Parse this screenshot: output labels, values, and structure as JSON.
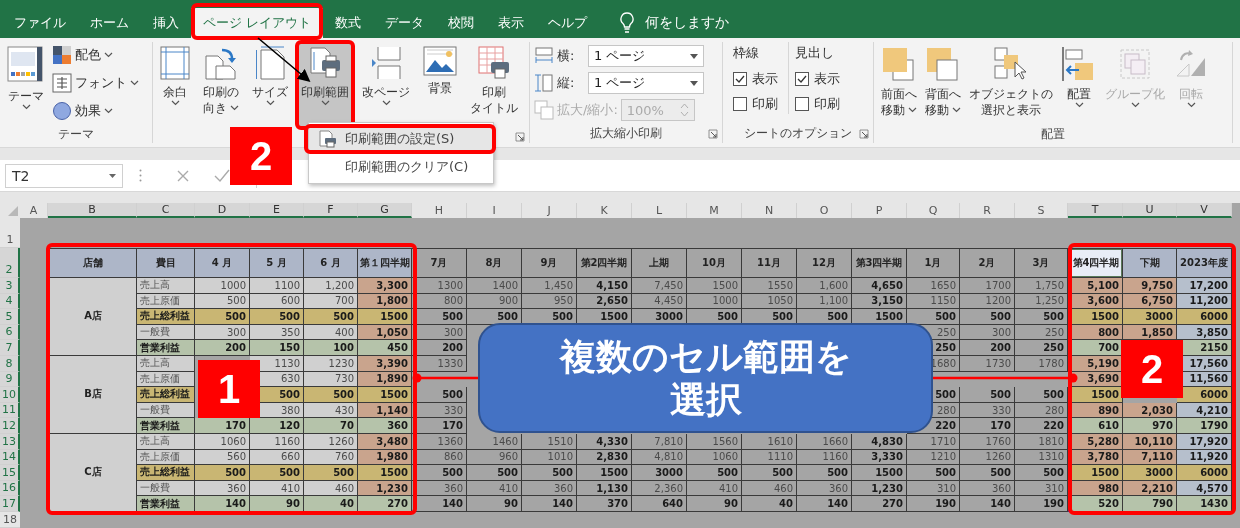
{
  "tabs": [
    {
      "label": "ファイル",
      "selected": false
    },
    {
      "label": "ホーム",
      "selected": false
    },
    {
      "label": "挿入",
      "selected": false
    },
    {
      "label": "ページ レイアウト",
      "selected": true
    },
    {
      "label": "数式",
      "selected": false
    },
    {
      "label": "データ",
      "selected": false
    },
    {
      "label": "校閲",
      "selected": false
    },
    {
      "label": "表示",
      "selected": false
    },
    {
      "label": "ヘルプ",
      "selected": false
    }
  ],
  "tell_me": {
    "placeholder": "何をしますか"
  },
  "ribbon": {
    "theme": {
      "label": "テーマ",
      "button": {
        "lines": [
          "テーマ"
        ],
        "dropdown": true
      },
      "options": [
        {
          "label": "配色"
        },
        {
          "label": "フォント"
        },
        {
          "label": "効果"
        }
      ]
    },
    "page_setup": {
      "buttons": [
        {
          "lines": [
            "余白"
          ],
          "dropdown": true,
          "pressed": false
        },
        {
          "lines": [
            "印刷の",
            "向き"
          ],
          "dropdown": true,
          "pressed": false
        },
        {
          "lines": [
            "サイズ"
          ],
          "dropdown": true,
          "pressed": false
        },
        {
          "lines": [
            "印刷範囲"
          ],
          "dropdown": true,
          "pressed": true
        },
        {
          "lines": [
            "改ページ"
          ],
          "dropdown": true,
          "pressed": false
        },
        {
          "lines": [
            "背景"
          ],
          "dropdown": false,
          "pressed": false
        },
        {
          "lines": [
            "印刷",
            "タイトル"
          ],
          "dropdown": false,
          "pressed": false
        }
      ]
    },
    "scale": {
      "label": "拡大縮小印刷",
      "fields": [
        {
          "label": "横:",
          "value": "1 ページ",
          "kind": "dropdown",
          "disabled": false
        },
        {
          "label": "縦:",
          "value": "1 ページ",
          "kind": "dropdown",
          "disabled": false
        },
        {
          "label": "拡大/縮小:",
          "value": "100%",
          "kind": "spinner",
          "disabled": true
        }
      ]
    },
    "sheet_options": {
      "label": "シートのオプション",
      "columns": [
        {
          "title": "枠線",
          "options": [
            {
              "label": "表示",
              "checked": true
            },
            {
              "label": "印刷",
              "checked": false
            }
          ]
        },
        {
          "title": "見出し",
          "options": [
            {
              "label": "表示",
              "checked": true
            },
            {
              "label": "印刷",
              "checked": false
            }
          ]
        }
      ]
    },
    "arrange": {
      "label": "配置",
      "buttons": [
        {
          "lines": [
            "前面へ",
            "移動"
          ],
          "dropdown": true,
          "disabled": false
        },
        {
          "lines": [
            "背面へ",
            "移動"
          ],
          "dropdown": true,
          "disabled": false
        },
        {
          "lines": [
            "オブジェクトの",
            "選択と表示"
          ],
          "dropdown": false,
          "disabled": false
        },
        {
          "lines": [
            "配置"
          ],
          "dropdown": true,
          "disabled": false
        },
        {
          "lines": [
            "グループ化"
          ],
          "dropdown": true,
          "disabled": true
        },
        {
          "lines": [
            "回転"
          ],
          "dropdown": true,
          "disabled": true
        }
      ]
    }
  },
  "print_area_menu": [
    {
      "label": "印刷範囲の設定(S)",
      "highlighted": true
    },
    {
      "label": "印刷範囲のクリア(C)",
      "highlighted": false
    }
  ],
  "name_box": "T2",
  "sheet": {
    "columns": [
      {
        "letter": "A",
        "selected": false
      },
      {
        "letter": "B",
        "selected": true,
        "print_area": true,
        "kind": "store",
        "header": "店舗",
        "active": false
      },
      {
        "letter": "C",
        "selected": true,
        "print_area": true,
        "kind": "item",
        "header": "費目",
        "active": false
      },
      {
        "letter": "D",
        "selected": true,
        "print_area": true,
        "kind": "month",
        "bold": false,
        "header": "4 月",
        "active": false
      },
      {
        "letter": "E",
        "selected": true,
        "print_area": true,
        "kind": "month",
        "bold": false,
        "header": "5 月",
        "active": false
      },
      {
        "letter": "F",
        "selected": true,
        "print_area": true,
        "kind": "month",
        "bold": false,
        "header": "6 月",
        "active": false
      },
      {
        "letter": "G",
        "selected": true,
        "print_area": true,
        "kind": "quarter",
        "bold": true,
        "header": "第１四半期",
        "active": false
      },
      {
        "letter": "H",
        "selected": false,
        "print_area": false,
        "bold": false,
        "header": "7月",
        "active": false
      },
      {
        "letter": "I",
        "selected": false,
        "print_area": false,
        "bold": false,
        "header": "8月",
        "active": false
      },
      {
        "letter": "J",
        "selected": false,
        "print_area": false,
        "bold": false,
        "header": "9月",
        "active": false
      },
      {
        "letter": "K",
        "selected": false,
        "print_area": false,
        "bold": true,
        "header": "第2四半期",
        "active": false
      },
      {
        "letter": "L",
        "selected": false,
        "print_area": false,
        "bold": false,
        "header": "上期",
        "active": false
      },
      {
        "letter": "M",
        "selected": false,
        "print_area": false,
        "bold": false,
        "header": "10月",
        "active": false
      },
      {
        "letter": "N",
        "selected": false,
        "print_area": false,
        "bold": false,
        "header": "11月",
        "active": false
      },
      {
        "letter": "O",
        "selected": false,
        "print_area": false,
        "bold": false,
        "header": "12月",
        "active": false
      },
      {
        "letter": "P",
        "selected": false,
        "print_area": false,
        "bold": true,
        "header": "第3四半期",
        "active": false
      },
      {
        "letter": "Q",
        "selected": false,
        "print_area": false,
        "bold": false,
        "header": "1月",
        "active": false
      },
      {
        "letter": "R",
        "selected": false,
        "print_area": false,
        "bold": false,
        "header": "2月",
        "active": false
      },
      {
        "letter": "S",
        "selected": false,
        "print_area": false,
        "bold": false,
        "header": "3月",
        "active": false
      },
      {
        "letter": "T",
        "selected": true,
        "print_area": true,
        "kind": "quarter",
        "bold": true,
        "header": "第4四半期",
        "active": true
      },
      {
        "letter": "U",
        "selected": true,
        "print_area": true,
        "kind": "half",
        "bold": true,
        "header": "下期",
        "active": false
      },
      {
        "letter": "V",
        "selected": true,
        "print_area": true,
        "kind": "year",
        "bold": true,
        "header": "2023年度",
        "active": false
      }
    ],
    "row_numbers": [
      {
        "label": "1",
        "selected": false
      },
      {
        "label": "2",
        "selected": true
      },
      {
        "label": "3",
        "selected": true
      },
      {
        "label": "4",
        "selected": true
      },
      {
        "label": "5",
        "selected": true
      },
      {
        "label": "6",
        "selected": true
      },
      {
        "label": "7",
        "selected": true
      },
      {
        "label": "8",
        "selected": true
      },
      {
        "label": "9",
        "selected": true
      },
      {
        "label": "10",
        "selected": true
      },
      {
        "label": "11",
        "selected": true
      },
      {
        "label": "12",
        "selected": true
      },
      {
        "label": "13",
        "selected": true
      },
      {
        "label": "14",
        "selected": true
      },
      {
        "label": "15",
        "selected": true
      },
      {
        "label": "16",
        "selected": true
      },
      {
        "label": "17",
        "selected": true
      },
      {
        "label": "18",
        "selected": false
      }
    ],
    "stores": [
      {
        "name": "A店",
        "rows": [
          {
            "item": "売上高",
            "kind": "sales",
            "values": {
              "D": "1000",
              "E": "1100",
              "F": "1,200",
              "G": "3,300",
              "H": "1300",
              "I": "1400",
              "J": "1,450",
              "K": "4,150",
              "L": "7,450",
              "M": "1500",
              "N": "1550",
              "O": "1,600",
              "P": "4,650",
              "Q": "1650",
              "R": "1700",
              "S": "1,750",
              "T": "5,100",
              "U": "9,750",
              "V": "17,200"
            }
          },
          {
            "item": "売上原価",
            "kind": "cost",
            "values": {
              "D": "500",
              "E": "600",
              "F": "700",
              "G": "1,800",
              "H": "800",
              "I": "900",
              "J": "950",
              "K": "2,650",
              "L": "4,450",
              "M": "1000",
              "N": "1050",
              "O": "1,100",
              "P": "3,150",
              "Q": "1150",
              "R": "1200",
              "S": "1,250",
              "T": "3,600",
              "U": "6,750",
              "V": "11,200"
            }
          },
          {
            "item": "売上総利益",
            "kind": "gross",
            "values": {
              "D": "500",
              "E": "500",
              "F": "500",
              "G": "1500",
              "H": "500",
              "I": "500",
              "J": "500",
              "K": "1500",
              "L": "3000",
              "M": "500",
              "N": "500",
              "O": "500",
              "P": "1500",
              "Q": "500",
              "R": "500",
              "S": "500",
              "T": "1500",
              "U": "3000",
              "V": "6000"
            }
          },
          {
            "item": "一般費",
            "kind": "expense",
            "values": {
              "D": "300",
              "E": "350",
              "F": "400",
              "G": "1,050",
              "H": "300",
              "Q": "250",
              "R": "300",
              "S": "250",
              "T": "800",
              "U": "1,850",
              "V": "3,850"
            }
          },
          {
            "item": "営業利益",
            "kind": "operating",
            "values": {
              "D": "200",
              "E": "150",
              "F": "100",
              "G": "450",
              "H": "200",
              "Q": "250",
              "R": "200",
              "S": "250",
              "T": "700",
              "V": "2150"
            }
          }
        ]
      },
      {
        "name": "B店",
        "rows": [
          {
            "item": "売上高",
            "kind": "sales",
            "values": {
              "E": "1130",
              "F": "1230",
              "G": "3,390",
              "H": "1330",
              "Q": "1680",
              "R": "1730",
              "S": "1780",
              "T": "5,190",
              "V": "17,560"
            }
          },
          {
            "item": "売上原価",
            "kind": "cost",
            "values": {
              "E": "630",
              "F": "730",
              "G": "1,890",
              "T": "3,690",
              "V": "11,560"
            }
          },
          {
            "item": "売上総利益",
            "kind": "gross",
            "values": {
              "E": "500",
              "F": "500",
              "G": "1500",
              "H": "500",
              "Q": "500",
              "R": "500",
              "S": "500",
              "T": "1500",
              "V": "6000"
            }
          },
          {
            "item": "一般費",
            "kind": "expense",
            "values": {
              "E": "380",
              "F": "430",
              "G": "1,140",
              "H": "330",
              "Q": "280",
              "R": "330",
              "S": "280",
              "T": "890",
              "U": "2,030",
              "V": "4,210"
            }
          },
          {
            "item": "営業利益",
            "kind": "operating",
            "values": {
              "D": "170",
              "E": "120",
              "F": "70",
              "G": "360",
              "H": "170",
              "Q": "220",
              "R": "170",
              "S": "220",
              "T": "610",
              "U": "970",
              "V": "1790"
            }
          }
        ]
      },
      {
        "name": "C店",
        "rows": [
          {
            "item": "売上高",
            "kind": "sales",
            "values": {
              "D": "1060",
              "E": "1160",
              "F": "1260",
              "G": "3,480",
              "H": "1360",
              "I": "1460",
              "J": "1510",
              "K": "4,330",
              "L": "7,810",
              "M": "1560",
              "N": "1610",
              "O": "1660",
              "P": "4,830",
              "Q": "1710",
              "R": "1760",
              "S": "1810",
              "T": "5,280",
              "U": "10,110",
              "V": "17,920"
            }
          },
          {
            "item": "売上原価",
            "kind": "cost",
            "values": {
              "D": "560",
              "E": "660",
              "F": "760",
              "G": "1,980",
              "H": "860",
              "I": "960",
              "J": "1010",
              "K": "2,830",
              "L": "4,810",
              "M": "1060",
              "N": "1110",
              "O": "1160",
              "P": "3,330",
              "Q": "1210",
              "R": "1260",
              "S": "1310",
              "T": "3,780",
              "U": "7,110",
              "V": "11,920"
            }
          },
          {
            "item": "売上総利益",
            "kind": "gross",
            "values": {
              "D": "500",
              "E": "500",
              "F": "500",
              "G": "1500",
              "H": "500",
              "I": "500",
              "J": "500",
              "K": "1500",
              "L": "3000",
              "M": "500",
              "N": "500",
              "O": "500",
              "P": "1500",
              "Q": "500",
              "R": "500",
              "S": "500",
              "T": "1500",
              "U": "3000",
              "V": "6000"
            }
          },
          {
            "item": "一般費",
            "kind": "expense",
            "values": {
              "D": "360",
              "E": "410",
              "F": "460",
              "G": "1,230",
              "H": "360",
              "I": "410",
              "J": "360",
              "K": "1,130",
              "L": "2,360",
              "M": "410",
              "N": "460",
              "O": "360",
              "P": "1,230",
              "Q": "310",
              "R": "360",
              "S": "310",
              "T": "980",
              "U": "2,210",
              "V": "4,570"
            }
          },
          {
            "item": "営業利益",
            "kind": "operating",
            "values": {
              "D": "140",
              "E": "90",
              "F": "40",
              "G": "270",
              "H": "140",
              "I": "90",
              "J": "140",
              "K": "370",
              "L": "640",
              "M": "90",
              "N": "40",
              "O": "140",
              "P": "270",
              "Q": "190",
              "R": "140",
              "S": "190",
              "T": "520",
              "U": "790",
              "V": "1430"
            }
          }
        ]
      }
    ]
  },
  "annotations": {
    "badges": [
      "2",
      "1",
      "2"
    ],
    "callout": "複数のセル範囲を選択"
  }
}
